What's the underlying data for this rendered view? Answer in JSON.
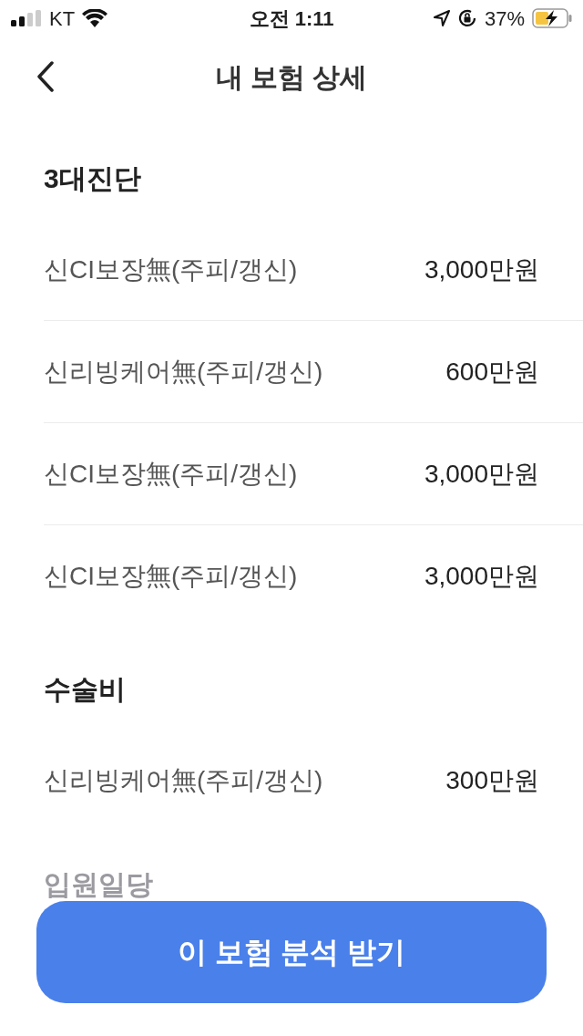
{
  "status_bar": {
    "carrier": "KT",
    "time": "오전 1:11",
    "battery": "37%"
  },
  "header": {
    "title": "내 보험 상세"
  },
  "sections": [
    {
      "title": "3대진단",
      "rows": [
        {
          "name": "신CI보장無(주피/갱신)",
          "amount": "3,000만원"
        },
        {
          "name": "신리빙케어無(주피/갱신)",
          "amount": "600만원"
        },
        {
          "name": "신CI보장無(주피/갱신)",
          "amount": "3,000만원"
        },
        {
          "name": "신CI보장無(주피/갱신)",
          "amount": "3,000만원"
        }
      ]
    },
    {
      "title": "수술비",
      "rows": [
        {
          "name": "신리빙케어無(주피/갱신)",
          "amount": "300만원"
        }
      ]
    },
    {
      "title": "입원일당"
    }
  ],
  "primary_button": {
    "label": "이 보험 분석 받기"
  }
}
